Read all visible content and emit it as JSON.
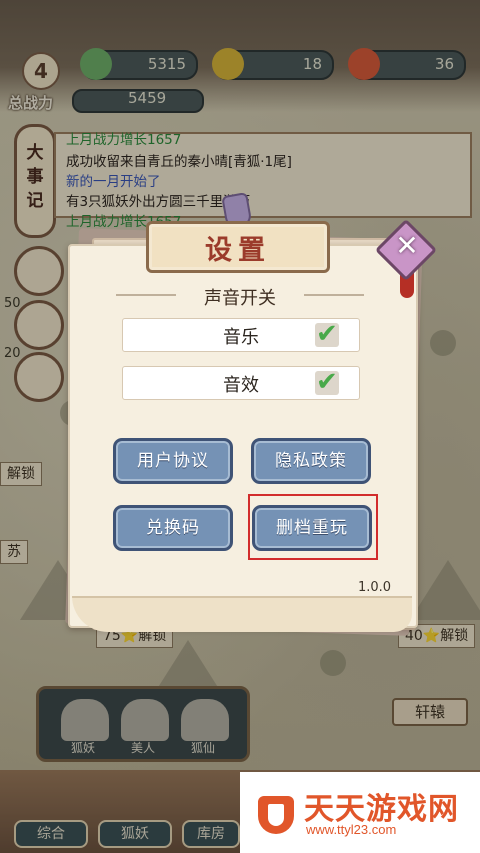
{
  "hud": {
    "level": "4",
    "resources": [
      {
        "value": "5315",
        "icon": "jade-icon",
        "color": "#6fb06a"
      },
      {
        "value": "18",
        "icon": "gold-ingot-icon",
        "color": "#d9b63a"
      },
      {
        "value": "36",
        "icon": "peach-icon",
        "color": "#d85c3b"
      }
    ],
    "power_label": "总战力",
    "power_value": "5459"
  },
  "event_log": {
    "tag": [
      "大",
      "事",
      "记"
    ],
    "lines": [
      {
        "text": "上月战力增长1657",
        "color": "#2c8c3c"
      },
      {
        "text": "成功收留来自青丘的秦小晴[青狐·1尾]",
        "color": "#2d2620"
      },
      {
        "text": "新的一月开始了",
        "color": "#3a57b8"
      },
      {
        "text": "有3只狐妖外出方圆三千里游历",
        "color": "#2d2620"
      },
      {
        "text": "上月战力增长1657",
        "color": "#2c8c3c"
      }
    ]
  },
  "map": {
    "side_counts": [
      "50",
      "20"
    ],
    "unlock_left": "解锁",
    "place_su": "苏",
    "unlock_75": "75⭐解锁",
    "unlock_40": "40⭐解锁",
    "place_xuanyuan": "轩辕"
  },
  "characters": [
    {
      "name": "狐妖"
    },
    {
      "name": "美人"
    },
    {
      "name": "狐仙"
    }
  ],
  "bottom_tabs": [
    "综合",
    "狐妖",
    "库房"
  ],
  "settings": {
    "title": "设置",
    "sound_section": "声音开关",
    "music_label": "音乐",
    "sfx_label": "音效",
    "music_on": true,
    "sfx_on": true,
    "user_agreement": "用户协议",
    "privacy_policy": "隐私政策",
    "redeem_code": "兑换码",
    "delete_restart": "删档重玩",
    "version": "1.0.0",
    "check_color": "#49a94a",
    "button_color": "#7592b5",
    "highlight_color": "#d22c2c"
  },
  "watermark": {
    "title": "天天游戏网",
    "url": "www.ttyl23.com"
  }
}
